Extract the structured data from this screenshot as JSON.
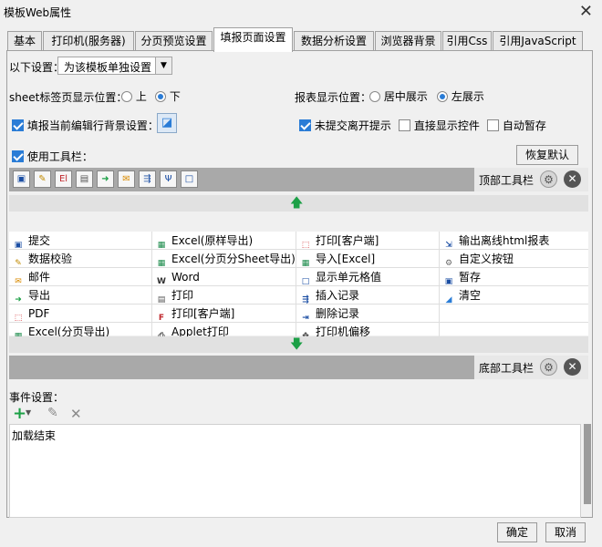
{
  "window": {
    "title": "模板Web属性",
    "close_glyph": "✕"
  },
  "tabs": [
    {
      "label": "基本",
      "active": false
    },
    {
      "label": "打印机(服务器)",
      "active": false
    },
    {
      "label": "分页预览设置",
      "active": false
    },
    {
      "label": "填报页面设置",
      "active": true
    },
    {
      "label": "数据分析设置",
      "active": false
    },
    {
      "label": "浏览器背景",
      "active": false
    },
    {
      "label": "引用Css",
      "active": false
    },
    {
      "label": "引用JavaScript",
      "active": false
    }
  ],
  "settings": {
    "label": "以下设置：",
    "select_value": "为该模板单独设置",
    "sheet_pos_label": "sheet标签页显示位置：",
    "sheet_top": "上",
    "sheet_bottom": "下",
    "sheet_selected": "下",
    "report_pos_label": "报表显示位置：",
    "report_center": "居中展示",
    "report_left": "左展示",
    "report_selected": "左展示",
    "fill_bg_label": "填报当前编辑行背景设置：",
    "unsubmitted_label": "未提交离开提示",
    "direct_show_label": "直接显示控件",
    "auto_save_label": "自动暂存",
    "use_toolbar_label": "使用工具栏：",
    "restore_default": "恢复默认"
  },
  "toolbar": {
    "top_label": "顶部工具栏",
    "bottom_label": "底部工具栏",
    "top_icons": [
      "save-icon",
      "edit-icon",
      "excel-icon",
      "print-icon",
      "export-icon",
      "mail-icon",
      "insert-icon",
      "delete-icon",
      "cell-icon"
    ]
  },
  "buttons": {
    "col1": [
      "提交",
      "数据校验",
      "邮件",
      "导出",
      "PDF",
      "Excel(分页导出)"
    ],
    "col2": [
      "Excel(原样导出)",
      "Excel(分页分Sheet导出)",
      "Word",
      "打印",
      "打印[客户端]",
      "Applet打印"
    ],
    "col3": [
      "打印[客户端]",
      "导入[Excel]",
      "显示单元格值",
      "插入记录",
      "删除记录",
      "打印机偏移"
    ],
    "col4": [
      "输出离线html报表",
      "自定义按钮",
      "暂存",
      "清空"
    ]
  },
  "events": {
    "label": "事件设置：",
    "items": [
      "加载结束"
    ]
  },
  "footer": {
    "ok": "确定",
    "cancel": "取消"
  },
  "colors": {
    "accent": "#2a7cd6",
    "toolbar_bg": "#a9a9a9",
    "green_arrow": "#1ca046"
  }
}
